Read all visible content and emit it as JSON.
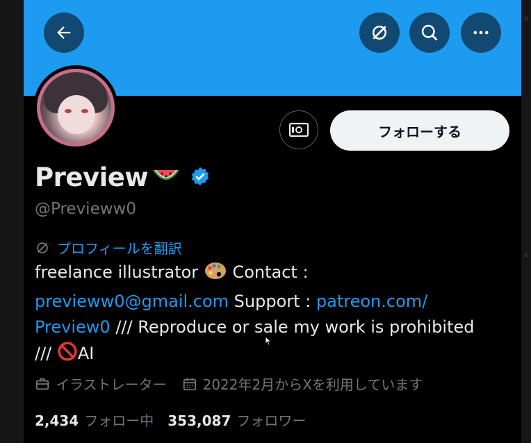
{
  "header": {
    "back_icon": "arrow-left-icon",
    "translate_icon": "translate-slash-icon",
    "search_icon": "search-icon",
    "more_icon": "more-horizontal-icon",
    "banner_color": "#1d9bf0"
  },
  "actions": {
    "subscribe_icon": "money-icon",
    "follow_label": "フォローする"
  },
  "profile": {
    "display_name": "Preview",
    "name_emoji": "watermelon",
    "verified": true,
    "handle": "@Previeww0",
    "translate_label": "プロフィールを翻訳"
  },
  "bio": {
    "part1": "freelance illustrator",
    "palette_emoji": "artist-palette",
    "part2": " Contact :",
    "email": "previeww0@gmail.com",
    "part3": " Support : ",
    "patreon_a": "patreon.com/",
    "patreon_b": "Preview0",
    "part4": " /// Reproduce or sale my work is prohibited /// ",
    "no_emoji": "prohibited",
    "part5": "AI"
  },
  "meta": {
    "profession": "イラストレーター",
    "joined": "2022年2月からXを利用しています"
  },
  "stats": {
    "following_count": "2,434",
    "following_label": "フォロー中",
    "followers_count": "353,087",
    "followers_label": "フォロワー"
  },
  "colors": {
    "accent": "#1d9bf0",
    "verified": "#1d9bf0",
    "muted": "#71767b"
  }
}
